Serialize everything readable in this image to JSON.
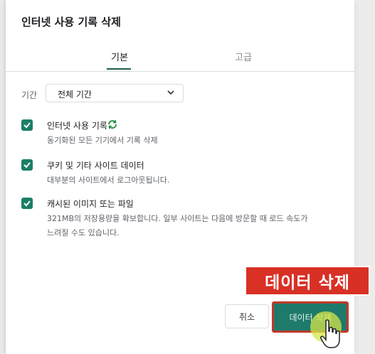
{
  "dialog": {
    "title": "인터넷 사용 기록 삭제",
    "tabs": [
      {
        "label": "기본",
        "active": true
      },
      {
        "label": "고급",
        "active": false
      }
    ],
    "period": {
      "label": "기간",
      "value": "전체 기간"
    },
    "options": [
      {
        "title": "인터넷 사용 기록",
        "description": "동기화된 모든 기기에서 기록 삭제",
        "checked": true,
        "icon": "sync-icon"
      },
      {
        "title": "쿠키 및 기타 사이트 데이터",
        "description": "대부분의 사이트에서 로그아웃됩니다.",
        "checked": true
      },
      {
        "title": "캐시된 이미지 또는 파일",
        "description_lines": [
          "321MB의 저장용량을 확보합니다. 일부 사이트는 다음에 방문할 때 로드 속도가",
          "느려질 수도 있습니다."
        ],
        "checked": true
      }
    ],
    "buttons": {
      "cancel": "취소",
      "delete": "데이터 삭제"
    }
  },
  "overlay": {
    "callout": "데이터 삭제"
  },
  "colors": {
    "accent": "#1a7f66",
    "callout_bg": "#d93025",
    "highlight": "#d4e64a"
  }
}
